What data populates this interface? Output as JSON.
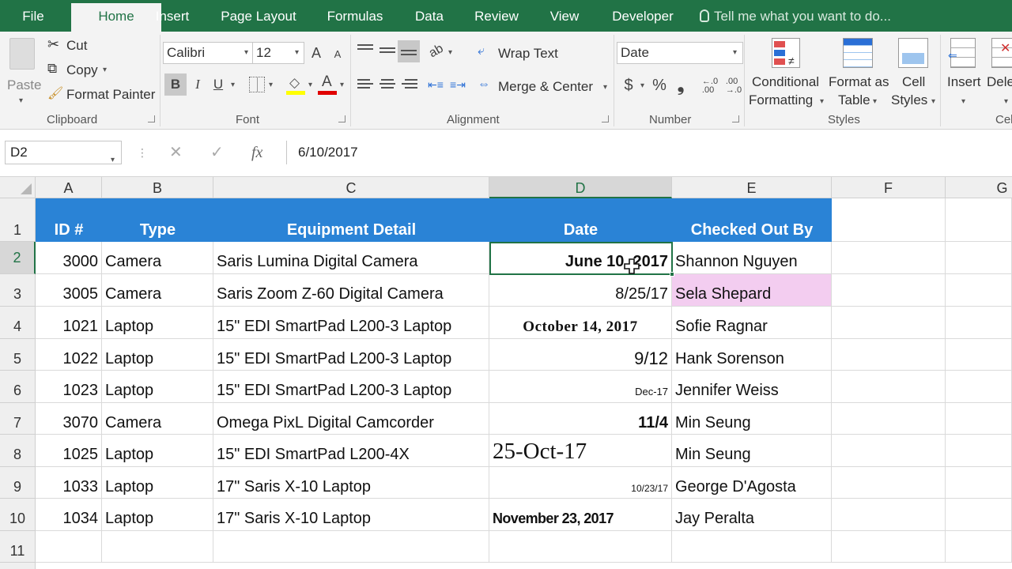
{
  "tabs": [
    {
      "label": "File"
    },
    {
      "label": "Home",
      "active": true
    },
    {
      "label": "Insert"
    },
    {
      "label": "Page Layout"
    },
    {
      "label": "Formulas"
    },
    {
      "label": "Data"
    },
    {
      "label": "Review"
    },
    {
      "label": "View"
    },
    {
      "label": "Developer"
    }
  ],
  "tellme": "Tell me what you want to do...",
  "ribbon": {
    "clipboard": {
      "paste": "Paste",
      "cut": "Cut",
      "copy": "Copy",
      "format_painter": "Format Painter",
      "group": "Clipboard"
    },
    "font": {
      "name": "Calibri",
      "size": "12",
      "grow": "A",
      "shrink": "A",
      "bold": "B",
      "italic": "I",
      "underline": "U",
      "group": "Font"
    },
    "alignment": {
      "wrap_text": "Wrap Text",
      "merge_center": "Merge & Center",
      "group": "Alignment"
    },
    "number": {
      "format": "Date",
      "currency": "$",
      "percent": "%",
      "comma": "❟",
      "group": "Number"
    },
    "styles": {
      "conditional": "Conditional",
      "conditional2": "Formatting",
      "format_table": "Format as",
      "format_table2": "Table",
      "cell_styles": "Cell",
      "cell_styles2": "Styles",
      "group": "Styles"
    },
    "cells": {
      "insert": "Insert",
      "delete": "Dele",
      "group": "Cel"
    }
  },
  "formula_bar": {
    "name_box": "D2",
    "value": "6/10/2017",
    "fx": "fx"
  },
  "columns": [
    "A",
    "B",
    "C",
    "D",
    "E",
    "F",
    "G"
  ],
  "rows": [
    "1",
    "2",
    "3",
    "4",
    "5",
    "6",
    "7",
    "8",
    "9",
    "10",
    "11"
  ],
  "headers": [
    "ID #",
    "Type",
    "Equipment Detail",
    "Date",
    "Checked Out By"
  ],
  "data": [
    {
      "id": "3000",
      "type": "Camera",
      "detail": "Saris Lumina Digital Camera",
      "date": "June 10, 2017",
      "by": "Shannon Nguyen"
    },
    {
      "id": "3005",
      "type": "Camera",
      "detail": "Saris Zoom Z-60 Digital Camera",
      "date": "8/25/17",
      "by": "Sela Shepard"
    },
    {
      "id": "1021",
      "type": "Laptop",
      "detail": "15\" EDI SmartPad L200-3 Laptop",
      "date": "October 14, 2017",
      "by": "Sofie Ragnar"
    },
    {
      "id": "1022",
      "type": "Laptop",
      "detail": "15\" EDI SmartPad L200-3 Laptop",
      "date": "9/12",
      "by": "Hank Sorenson"
    },
    {
      "id": "1023",
      "type": "Laptop",
      "detail": "15\" EDI SmartPad L200-3 Laptop",
      "date": "Dec-17",
      "by": "Jennifer Weiss"
    },
    {
      "id": "3070",
      "type": "Camera",
      "detail": "Omega PixL Digital Camcorder",
      "date": "11/4",
      "by": "Min Seung"
    },
    {
      "id": "1025",
      "type": "Laptop",
      "detail": "15\" EDI SmartPad L200-4X",
      "date": "25-Oct-17",
      "by": "Min Seung"
    },
    {
      "id": "1033",
      "type": "Laptop",
      "detail": "17\" Saris X-10 Laptop",
      "date": "10/23/17",
      "by": "George D'Agosta"
    },
    {
      "id": "1034",
      "type": "Laptop",
      "detail": "17\" Saris X-10 Laptop",
      "date": "November 23, 2017",
      "by": "Jay Peralta"
    }
  ],
  "colors": {
    "accent": "#217346",
    "header_fill": "#2a83d6",
    "highlight_fill": "#f3cdf0"
  }
}
